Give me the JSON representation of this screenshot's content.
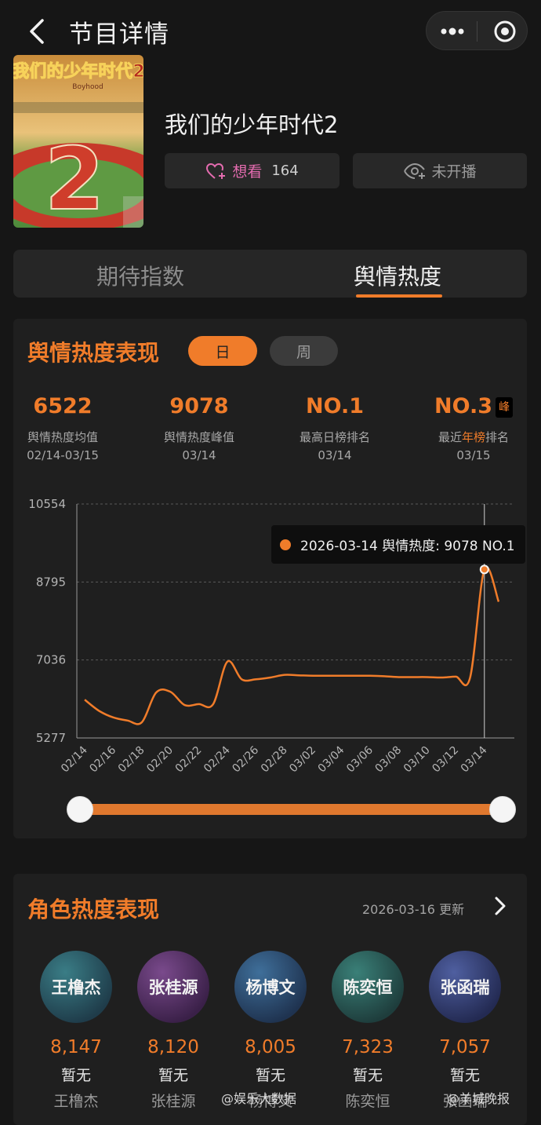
{
  "header": {
    "title": "节目详情"
  },
  "show": {
    "name": "我们的少年时代2",
    "poster_title": "我们的少年时代2",
    "poster_subtitle": "Boyhood",
    "want_label": "想看",
    "want_count": "164",
    "status_label": "未开播"
  },
  "tabs": [
    {
      "label": "期待指数"
    },
    {
      "label": "舆情热度"
    }
  ],
  "active_tab": 1,
  "heat": {
    "title": "舆情热度表现",
    "toggle": {
      "day": "日",
      "week": "周"
    },
    "stats": [
      {
        "value": "6522",
        "label": "舆情热度均值",
        "date": "02/14-03/15"
      },
      {
        "value": "9078",
        "label": "舆情热度峰值",
        "date": "03/14"
      },
      {
        "value": "NO.1",
        "label": "最高日榜排名",
        "date": "03/14"
      },
      {
        "value": "NO.3",
        "badge": "峰",
        "label_pre": "最近",
        "label_hl": "年榜",
        "label_post": "排名",
        "date": "03/15"
      }
    ],
    "tooltip": "2026-03-14 舆情热度: 9078 NO.1"
  },
  "chart_data": {
    "type": "line",
    "x": [
      "02/14",
      "02/15",
      "02/16",
      "02/17",
      "02/18",
      "02/19",
      "02/20",
      "02/21",
      "02/22",
      "02/23",
      "02/24",
      "02/25",
      "02/26",
      "02/27",
      "02/28",
      "03/01",
      "03/02",
      "03/03",
      "03/04",
      "03/05",
      "03/06",
      "03/07",
      "03/08",
      "03/09",
      "03/10",
      "03/11",
      "03/12",
      "03/13",
      "03/14",
      "03/15"
    ],
    "xticks": [
      "02/14",
      "02/16",
      "02/18",
      "02/20",
      "02/22",
      "02/24",
      "02/26",
      "02/28",
      "03/02",
      "03/04",
      "03/06",
      "03/08",
      "03/10",
      "03/12",
      "03/14"
    ],
    "yticks": [
      5277,
      7036,
      8795,
      10554
    ],
    "ylim": [
      5277,
      10554
    ],
    "series": [
      {
        "values": [
          6140,
          5890,
          5740,
          5670,
          5630,
          6300,
          6320,
          6020,
          6040,
          6040,
          7000,
          6600,
          6600,
          6640,
          6700,
          6690,
          6680,
          6680,
          6680,
          6680,
          6680,
          6670,
          6650,
          6650,
          6650,
          6640,
          6660,
          6640,
          9078,
          8350
        ]
      }
    ],
    "highlight": {
      "x": "03/14",
      "value": 9078
    },
    "color": "#f07c2a"
  },
  "roles": {
    "title": "角色热度表现",
    "updated": "2026-03-16 更新",
    "items": [
      {
        "name": "王橹杰",
        "score": "8,147",
        "rank": "暂无",
        "actor": "王橹杰"
      },
      {
        "name": "张桂源",
        "score": "8,120",
        "rank": "暂无",
        "actor": "张桂源"
      },
      {
        "name": "杨博文",
        "score": "8,005",
        "rank": "暂无",
        "actor": "杨博文"
      },
      {
        "name": "陈奕恒",
        "score": "7,323",
        "rank": "暂无",
        "actor": "陈奕恒"
      },
      {
        "name": "张函瑞",
        "score": "7,057",
        "rank": "暂无",
        "actor": "张函瑞"
      }
    ]
  },
  "watermarks": [
    "@娱乐大数据",
    "@羊城晚报"
  ],
  "colors": {
    "accent": "#f07c2a",
    "background": "#161616",
    "card": "#1f1f1f"
  }
}
